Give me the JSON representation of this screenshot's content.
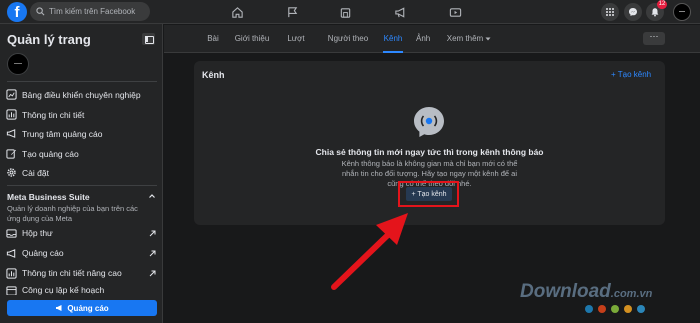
{
  "topbar": {
    "search_placeholder": "Tìm kiếm trên Facebook",
    "logo": "f",
    "nav_icons": [
      "home-icon",
      "flag-icon",
      "marketplace-icon",
      "megaphone-icon",
      "watch-icon"
    ],
    "right_icons": [
      "menu-grid-icon",
      "messenger-icon",
      "bell-icon"
    ],
    "notification_count": "12"
  },
  "sidebar": {
    "title": "Quản lý trang",
    "items": [
      {
        "label": "Bảng điều khiển chuyên nghiệp",
        "icon": "dashboard-icon"
      },
      {
        "label": "Thông tin chi tiết",
        "icon": "insights-icon"
      },
      {
        "label": "Trung tâm quảng cáo",
        "icon": "megaphone-icon"
      },
      {
        "label": "Tạo quảng cáo",
        "icon": "edit-icon"
      },
      {
        "label": "Cài đặt",
        "icon": "gear-icon"
      }
    ],
    "meta": {
      "title": "Meta Business Suite",
      "description": "Quản lý doanh nghiệp của bạn trên các ứng dụng của Meta",
      "links": [
        {
          "label": "Hộp thư",
          "icon": "inbox-icon"
        },
        {
          "label": "Quảng cáo",
          "icon": "megaphone-icon"
        },
        {
          "label": "Thông tin chi tiết nâng cao",
          "icon": "insights-icon"
        },
        {
          "label": "Công cụ lập kế hoạch",
          "icon": "calendar-icon"
        }
      ]
    },
    "ads_button": "Quảng cáo"
  },
  "tabs": {
    "items": [
      "Bài viết",
      "Giới thiệu",
      "Lượt nhắc",
      "Người theo dõi",
      "Kênh",
      "Ảnh",
      "Xem thêm"
    ],
    "active": "Kênh",
    "more_button": "···"
  },
  "card": {
    "title": "Kênh",
    "create_link": "+ Tạo kênh",
    "headline": "Chia sẻ thông tin mới ngay tức thì trong kênh thông báo",
    "description": "Kênh thông báo là không gian mà chỉ bạn mới có thể nhắn tin cho đối tượng. Hãy tạo ngay một kênh để ai cũng có thể theo dõi nhé.",
    "create_button": "+ Tạo kênh"
  },
  "watermark": {
    "text": "Download",
    "domain": ".com.vn",
    "dot_colors": [
      "#1e88c7",
      "#e5461b",
      "#8cc43f",
      "#f5a623",
      "#2f9ad6"
    ]
  },
  "colors": {
    "accent": "#2d88ff",
    "highlight": "#e4141b",
    "background": "#18191a",
    "surface": "#242526"
  }
}
